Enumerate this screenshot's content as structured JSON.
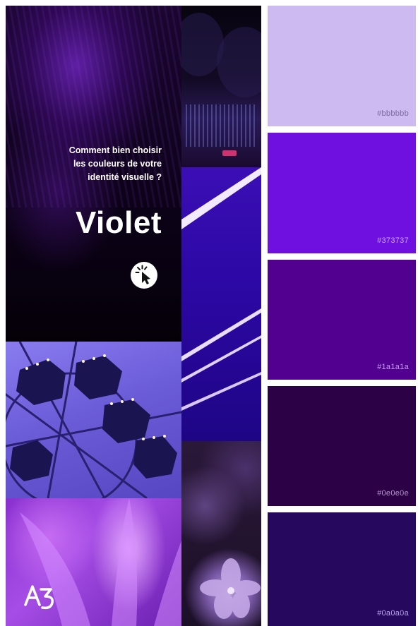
{
  "hero": {
    "intro": "Comment bien choisir\nles couleurs de votre\nidentité visuelle ?",
    "title": "Violet",
    "cursor_icon": "cursor-click-icon"
  },
  "images": {
    "street": "night-street-photo",
    "laser": "violet-laser-beams-photo",
    "flowers": "violet-flowers-photo",
    "wheel": "ferris-wheel-photo",
    "petals": "purple-petals-photo"
  },
  "logo": {
    "icon": "a3-logo-icon"
  },
  "swatches": [
    {
      "code": "#bbbbbb",
      "color": "#ccbaf0"
    },
    {
      "code": "#373737",
      "color": "#6f0fe0"
    },
    {
      "code": "#1a1a1a",
      "color": "#51008f"
    },
    {
      "code": "#0e0e0e",
      "color": "#2c0146"
    },
    {
      "code": "#0a0a0a",
      "color": "#26085e"
    }
  ]
}
